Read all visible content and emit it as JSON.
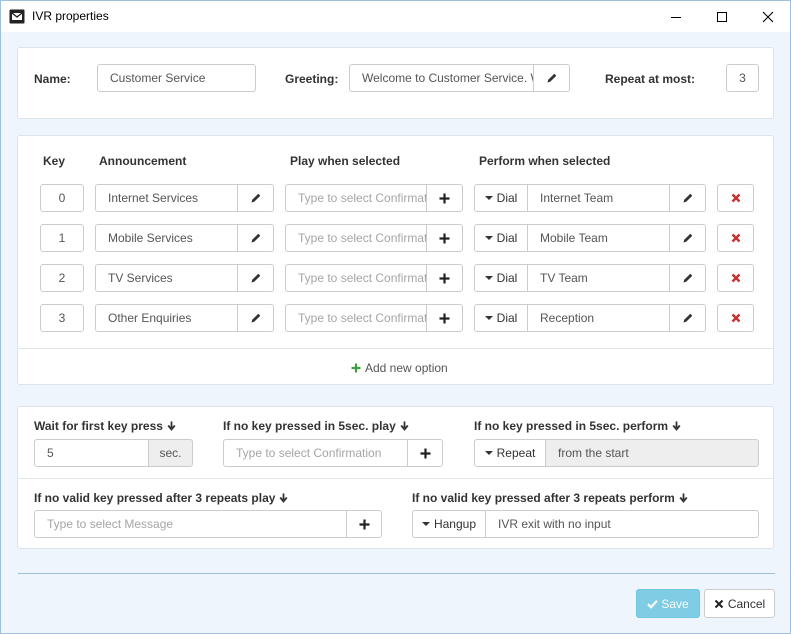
{
  "window": {
    "title": "IVR properties",
    "minimize_icon": "minimize-icon",
    "maximize_icon": "maximize-icon",
    "close_icon": "close-icon"
  },
  "header": {
    "name_label": "Name:",
    "name_value": "Customer Service",
    "greeting_label": "Greeting:",
    "greeting_value": "Welcome to Customer Service. W",
    "repeat_label": "Repeat at most:",
    "repeat_value": "3"
  },
  "options": {
    "columns": {
      "key": "Key",
      "announcement": "Announcement",
      "play": "Play when selected",
      "perform": "Perform when selected"
    },
    "rows": [
      {
        "key": "0",
        "announcement": "Internet Services",
        "play_placeholder": "Type to select Confirmat",
        "action": "Dial",
        "target": "Internet Team"
      },
      {
        "key": "1",
        "announcement": "Mobile Services",
        "play_placeholder": "Type to select Confirmat",
        "action": "Dial",
        "target": "Mobile Team"
      },
      {
        "key": "2",
        "announcement": "TV Services",
        "play_placeholder": "Type to select Confirmat",
        "action": "Dial",
        "target": "TV Team"
      },
      {
        "key": "3",
        "announcement": "Other Enquiries",
        "play_placeholder": "Type to select Confirmat",
        "action": "Dial",
        "target": "Reception"
      }
    ],
    "add_label": "Add new option"
  },
  "settings": {
    "wait_label": "Wait for first key press",
    "wait_value": "5",
    "wait_unit": "sec.",
    "nokey_play_label": "If no key pressed in 5sec. play",
    "nokey_play_placeholder": "Type to select Confirmation",
    "nokey_perform_label": "If no key pressed in 5sec. perform",
    "nokey_perform_action": "Repeat",
    "nokey_perform_value": "from the start",
    "invalid_play_label": "If no valid key pressed after 3 repeats play",
    "invalid_play_placeholder": "Type to select Message",
    "invalid_perform_label": "If no valid key pressed after 3 repeats perform",
    "invalid_perform_action": "Hangup",
    "invalid_perform_value": "IVR exit with no input"
  },
  "footer": {
    "save_label": "Save",
    "cancel_label": "Cancel"
  },
  "colors": {
    "accent": "#5bc0de",
    "danger": "#c9302c",
    "success": "#449d44",
    "border": "#9fc0dd"
  }
}
